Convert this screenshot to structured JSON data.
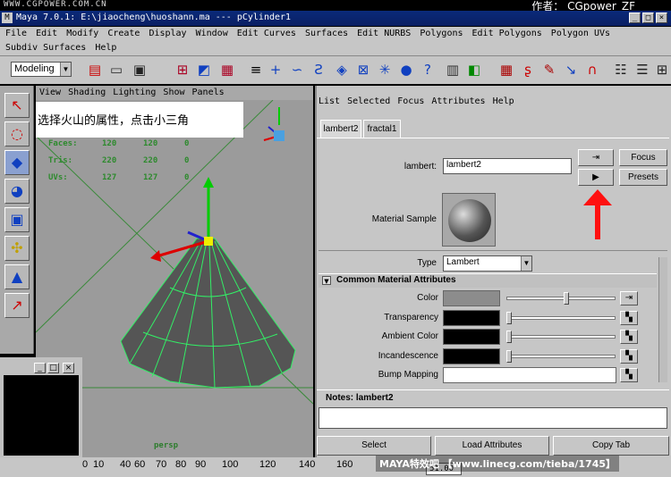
{
  "watermark": {
    "site": "WWW.CGPOWER.COM.CN",
    "author": "作者： CGpower_ZF",
    "footer": "MAYA特效吧  【www.linecg.com/tieba/1745】"
  },
  "window": {
    "title": "Maya 7.0.1: E:\\jiaocheng\\huoshann.ma   ---   pCylinder1"
  },
  "menus": {
    "main": [
      "File",
      "Edit",
      "Modify",
      "Create",
      "Display",
      "Window",
      "Edit Curves",
      "Surfaces",
      "Edit NURBS",
      "Polygons",
      "Edit Polygons",
      "Polygon UVs"
    ],
    "secondary": [
      "Subdiv Surfaces",
      "Help"
    ]
  },
  "statusline": {
    "mode": "Modeling"
  },
  "viewport": {
    "menu": [
      "View",
      "Shading",
      "Lighting",
      "Show",
      "Panels"
    ],
    "annotation": "选择火山的属性，点击小三角",
    "hud": [
      {
        "label": "Faces:",
        "v1": "120",
        "v2": "120",
        "v3": "0"
      },
      {
        "label": "Tris:",
        "v1": "220",
        "v2": "220",
        "v3": "0"
      },
      {
        "label": "UVs:",
        "v1": "127",
        "v2": "127",
        "v3": "0"
      }
    ],
    "camera": "persp"
  },
  "attribute_editor": {
    "menu": [
      "List",
      "Selected",
      "Focus",
      "Attributes",
      "Help"
    ],
    "tabs": [
      "lambert2",
      "fractal1"
    ],
    "node_label": "lambert:",
    "node_value": "lambert2",
    "focus_label": "Focus",
    "presets_label": "Presets",
    "material_sample_label": "Material Sample",
    "type_label": "Type",
    "type_value": "Lambert",
    "section_title": "Common Material Attributes",
    "attributes": [
      {
        "label": "Color",
        "swatch": "#8c8c8c",
        "slider": 0.55
      },
      {
        "label": "Transparency",
        "swatch": "#000000",
        "slider": 0.0
      },
      {
        "label": "Ambient Color",
        "swatch": "#000000",
        "slider": 0.0
      },
      {
        "label": "Incandescence",
        "swatch": "#000000",
        "slider": 0.0
      },
      {
        "label": "Bump Mapping",
        "swatch": "#ffffff",
        "slider": null
      }
    ],
    "notes_label": "Notes:  lambert2",
    "buttons": [
      "Select",
      "Load Attributes",
      "Copy Tab"
    ]
  },
  "timeline": {
    "ticks": [
      "0",
      "10",
      "40",
      "60",
      "70",
      "80",
      "90",
      "100",
      "120",
      "140",
      "160"
    ],
    "current": "51.00"
  }
}
